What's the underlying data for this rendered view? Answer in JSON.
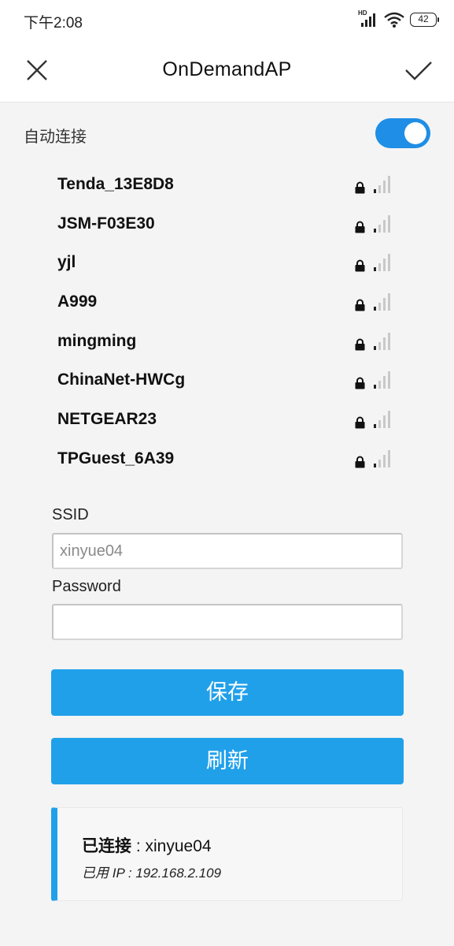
{
  "status_bar": {
    "time": "下午2:08",
    "battery": "42",
    "hd_label": "HD"
  },
  "header": {
    "title": "OnDemandAP",
    "close_icon": "close-icon",
    "confirm_icon": "check-icon"
  },
  "auto_connect": {
    "label": "自动连接",
    "enabled": true
  },
  "networks": [
    {
      "ssid": "Tenda_13E8D8",
      "secured": true,
      "signal_bars": 1
    },
    {
      "ssid": "JSM-F03E30",
      "secured": true,
      "signal_bars": 1
    },
    {
      "ssid": "yjl",
      "secured": true,
      "signal_bars": 1
    },
    {
      "ssid": "A999",
      "secured": true,
      "signal_bars": 1
    },
    {
      "ssid": "mingming",
      "secured": true,
      "signal_bars": 1
    },
    {
      "ssid": "ChinaNet-HWCg",
      "secured": true,
      "signal_bars": 1
    },
    {
      "ssid": "NETGEAR23",
      "secured": true,
      "signal_bars": 1
    },
    {
      "ssid": "TPGuest_6A39",
      "secured": true,
      "signal_bars": 1
    }
  ],
  "form": {
    "ssid_label": "SSID",
    "ssid_placeholder": "xinyue04",
    "ssid_value": "",
    "password_label": "Password",
    "password_value": "",
    "save_label": "保存",
    "refresh_label": "刷新"
  },
  "connection": {
    "status_label": "已连接",
    "separator": " : ",
    "ssid": "xinyue04",
    "ip_text": "已用 IP : 192.168.2.109"
  },
  "colors": {
    "accent": "#21a0ea",
    "toggle": "#1e8ee6",
    "signal_active": "#222222",
    "signal_inactive": "#c8c8c8"
  }
}
